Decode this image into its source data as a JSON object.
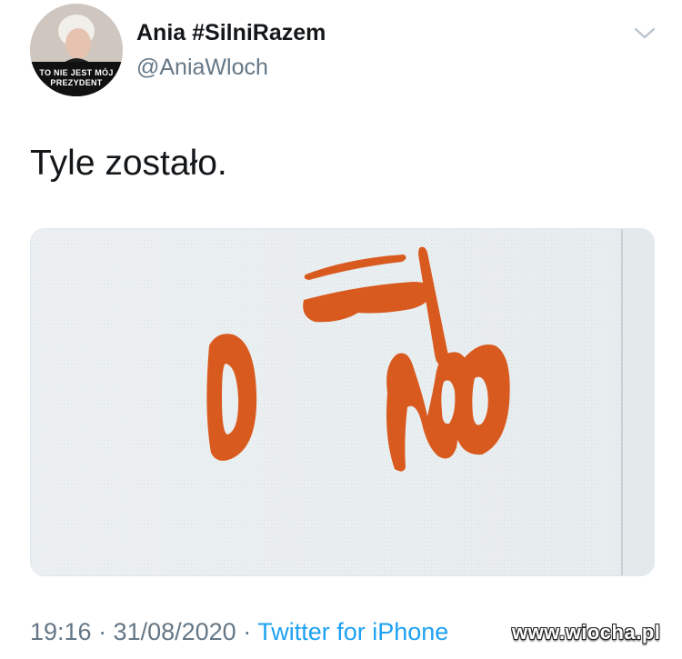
{
  "author": {
    "name": "Ania #SilniRazem",
    "handle": "@AniaWloch",
    "avatar_badge_line1": "TO NIE JEST MÓJ",
    "avatar_badge_line2": "PREZYDENT"
  },
  "tweet": {
    "text": "Tyle zostało.",
    "timestamp": "19:16 · 31/08/2020 · ",
    "source": "Twitter for iPhone"
  },
  "watermark": "www.wiocha.pl",
  "icons": {
    "menu": "chevron-down-icon"
  },
  "colors": {
    "text": "#14171a",
    "secondary": "#657786",
    "link": "#1da1f2",
    "paint": "#d95a1e"
  }
}
